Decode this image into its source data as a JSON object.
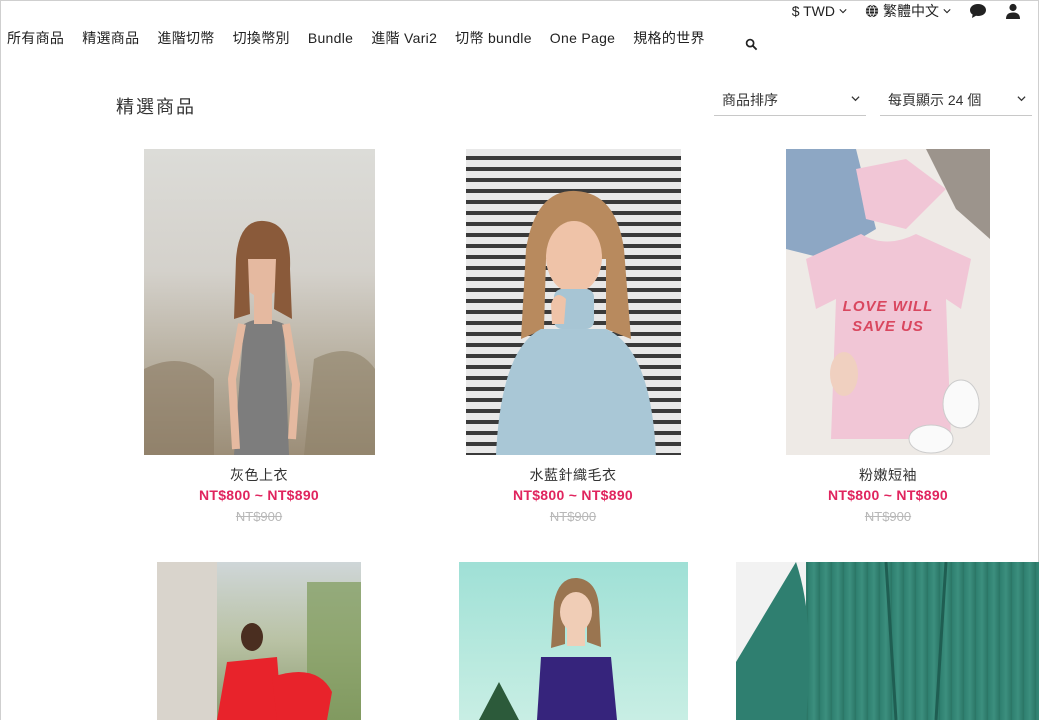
{
  "utility": {
    "currency": "$ TWD",
    "language": "繁體中文"
  },
  "nav": {
    "items": [
      "所有商品",
      "精選商品",
      "進階切幣",
      "切換幣別",
      "Bundle",
      "進階 Vari2",
      "切幣 bundle",
      "One Page",
      "規格的世界"
    ]
  },
  "page": {
    "title": "精選商品",
    "sort_label": "商品排序",
    "per_page_label": "每頁顯示 24 個"
  },
  "products": [
    {
      "name": "灰色上衣",
      "price": "NT$800 ~ NT$890",
      "original_price": "NT$900"
    },
    {
      "name": "水藍針織毛衣",
      "price": "NT$800 ~ NT$890",
      "original_price": "NT$900"
    },
    {
      "name": "粉嫩短袖",
      "price": "NT$800 ~ NT$890",
      "original_price": "NT$900"
    },
    {
      "name": "",
      "price": "",
      "original_price": ""
    },
    {
      "name": "",
      "price": "",
      "original_price": ""
    },
    {
      "name": "",
      "price": "",
      "original_price": ""
    }
  ],
  "product_images": [
    "woman-grey-dress-photo",
    "woman-blue-sweater-photo",
    "pink-tshirt-flatlay-photo",
    "woman-red-dress-photo",
    "woman-purple-lace-top-photo",
    "green-knit-sweater-photo"
  ],
  "shirt_print": [
    "LOVE WILL",
    "SAVE US"
  ],
  "colors": {
    "price": "#e0245e",
    "strikethrough": "#b8b8b8"
  }
}
